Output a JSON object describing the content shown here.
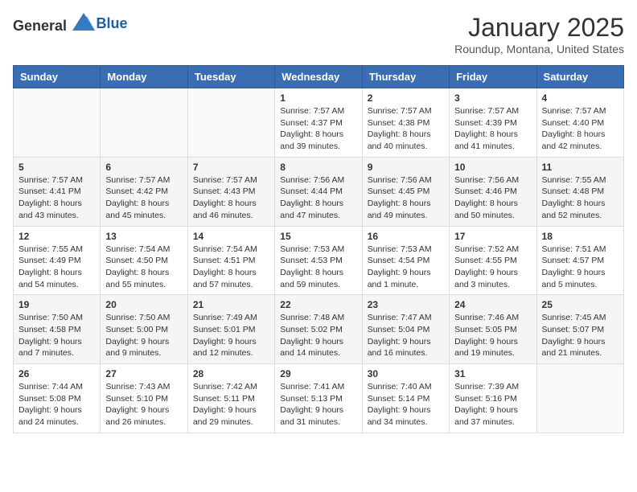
{
  "logo": {
    "text_general": "General",
    "text_blue": "Blue"
  },
  "header": {
    "month": "January 2025",
    "location": "Roundup, Montana, United States"
  },
  "days_of_week": [
    "Sunday",
    "Monday",
    "Tuesday",
    "Wednesday",
    "Thursday",
    "Friday",
    "Saturday"
  ],
  "weeks": [
    [
      {
        "day": "",
        "info": ""
      },
      {
        "day": "",
        "info": ""
      },
      {
        "day": "",
        "info": ""
      },
      {
        "day": "1",
        "info": "Sunrise: 7:57 AM\nSunset: 4:37 PM\nDaylight: 8 hours and 39 minutes."
      },
      {
        "day": "2",
        "info": "Sunrise: 7:57 AM\nSunset: 4:38 PM\nDaylight: 8 hours and 40 minutes."
      },
      {
        "day": "3",
        "info": "Sunrise: 7:57 AM\nSunset: 4:39 PM\nDaylight: 8 hours and 41 minutes."
      },
      {
        "day": "4",
        "info": "Sunrise: 7:57 AM\nSunset: 4:40 PM\nDaylight: 8 hours and 42 minutes."
      }
    ],
    [
      {
        "day": "5",
        "info": "Sunrise: 7:57 AM\nSunset: 4:41 PM\nDaylight: 8 hours and 43 minutes."
      },
      {
        "day": "6",
        "info": "Sunrise: 7:57 AM\nSunset: 4:42 PM\nDaylight: 8 hours and 45 minutes."
      },
      {
        "day": "7",
        "info": "Sunrise: 7:57 AM\nSunset: 4:43 PM\nDaylight: 8 hours and 46 minutes."
      },
      {
        "day": "8",
        "info": "Sunrise: 7:56 AM\nSunset: 4:44 PM\nDaylight: 8 hours and 47 minutes."
      },
      {
        "day": "9",
        "info": "Sunrise: 7:56 AM\nSunset: 4:45 PM\nDaylight: 8 hours and 49 minutes."
      },
      {
        "day": "10",
        "info": "Sunrise: 7:56 AM\nSunset: 4:46 PM\nDaylight: 8 hours and 50 minutes."
      },
      {
        "day": "11",
        "info": "Sunrise: 7:55 AM\nSunset: 4:48 PM\nDaylight: 8 hours and 52 minutes."
      }
    ],
    [
      {
        "day": "12",
        "info": "Sunrise: 7:55 AM\nSunset: 4:49 PM\nDaylight: 8 hours and 54 minutes."
      },
      {
        "day": "13",
        "info": "Sunrise: 7:54 AM\nSunset: 4:50 PM\nDaylight: 8 hours and 55 minutes."
      },
      {
        "day": "14",
        "info": "Sunrise: 7:54 AM\nSunset: 4:51 PM\nDaylight: 8 hours and 57 minutes."
      },
      {
        "day": "15",
        "info": "Sunrise: 7:53 AM\nSunset: 4:53 PM\nDaylight: 8 hours and 59 minutes."
      },
      {
        "day": "16",
        "info": "Sunrise: 7:53 AM\nSunset: 4:54 PM\nDaylight: 9 hours and 1 minute."
      },
      {
        "day": "17",
        "info": "Sunrise: 7:52 AM\nSunset: 4:55 PM\nDaylight: 9 hours and 3 minutes."
      },
      {
        "day": "18",
        "info": "Sunrise: 7:51 AM\nSunset: 4:57 PM\nDaylight: 9 hours and 5 minutes."
      }
    ],
    [
      {
        "day": "19",
        "info": "Sunrise: 7:50 AM\nSunset: 4:58 PM\nDaylight: 9 hours and 7 minutes."
      },
      {
        "day": "20",
        "info": "Sunrise: 7:50 AM\nSunset: 5:00 PM\nDaylight: 9 hours and 9 minutes."
      },
      {
        "day": "21",
        "info": "Sunrise: 7:49 AM\nSunset: 5:01 PM\nDaylight: 9 hours and 12 minutes."
      },
      {
        "day": "22",
        "info": "Sunrise: 7:48 AM\nSunset: 5:02 PM\nDaylight: 9 hours and 14 minutes."
      },
      {
        "day": "23",
        "info": "Sunrise: 7:47 AM\nSunset: 5:04 PM\nDaylight: 9 hours and 16 minutes."
      },
      {
        "day": "24",
        "info": "Sunrise: 7:46 AM\nSunset: 5:05 PM\nDaylight: 9 hours and 19 minutes."
      },
      {
        "day": "25",
        "info": "Sunrise: 7:45 AM\nSunset: 5:07 PM\nDaylight: 9 hours and 21 minutes."
      }
    ],
    [
      {
        "day": "26",
        "info": "Sunrise: 7:44 AM\nSunset: 5:08 PM\nDaylight: 9 hours and 24 minutes."
      },
      {
        "day": "27",
        "info": "Sunrise: 7:43 AM\nSunset: 5:10 PM\nDaylight: 9 hours and 26 minutes."
      },
      {
        "day": "28",
        "info": "Sunrise: 7:42 AM\nSunset: 5:11 PM\nDaylight: 9 hours and 29 minutes."
      },
      {
        "day": "29",
        "info": "Sunrise: 7:41 AM\nSunset: 5:13 PM\nDaylight: 9 hours and 31 minutes."
      },
      {
        "day": "30",
        "info": "Sunrise: 7:40 AM\nSunset: 5:14 PM\nDaylight: 9 hours and 34 minutes."
      },
      {
        "day": "31",
        "info": "Sunrise: 7:39 AM\nSunset: 5:16 PM\nDaylight: 9 hours and 37 minutes."
      },
      {
        "day": "",
        "info": ""
      }
    ]
  ]
}
